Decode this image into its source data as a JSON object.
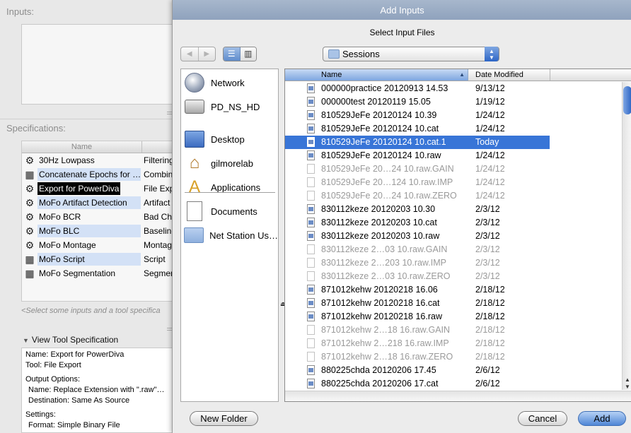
{
  "background": {
    "inputs_label": "Inputs:",
    "specifications_label": "Specifications:",
    "spec_table": {
      "header": "Name",
      "rows": [
        {
          "icon": "gear-icon",
          "name": "30Hz Lowpass",
          "category": "Filtering",
          "style": "plain"
        },
        {
          "icon": "grid-icon",
          "name": "Concatenate Epochs for …",
          "category": "Combin",
          "style": "blue"
        },
        {
          "icon": "gear-icon",
          "name": "Export for PowerDiva",
          "category": "File Exp",
          "style": "selected"
        },
        {
          "icon": "gear-icon",
          "name": "MoFo Artifact Detection",
          "category": "Artifact",
          "style": "blue"
        },
        {
          "icon": "gear-icon",
          "name": "MoFo BCR",
          "category": "Bad Cha",
          "style": "plain"
        },
        {
          "icon": "gear-icon",
          "name": "MoFo BLC",
          "category": "Baseline",
          "style": "blue"
        },
        {
          "icon": "gear-icon",
          "name": "MoFo Montage",
          "category": "Montage",
          "style": "plain"
        },
        {
          "icon": "grid-icon",
          "name": "MoFo Script",
          "category": "Script",
          "style": "blue"
        },
        {
          "icon": "grid-icon",
          "name": "MoFo Segmentation",
          "category": "Segmen",
          "style": "plain"
        }
      ]
    },
    "hint": "<Select some inputs and a tool specifica",
    "view_tool_label": "View Tool Specification",
    "detail_lines": [
      {
        "text": "Name: Export for PowerDiva",
        "indent": false
      },
      {
        "text": "Tool: File Export",
        "indent": false
      },
      {
        "text": "",
        "indent": false
      },
      {
        "text": "Output Options:",
        "indent": false
      },
      {
        "text": "Name: Replace Extension with \".raw\"…",
        "indent": true
      },
      {
        "text": "Destination: Same As Source",
        "indent": true
      },
      {
        "text": "",
        "indent": false
      },
      {
        "text": "Settings:",
        "indent": false
      },
      {
        "text": "Format: Simple Binary File",
        "indent": true
      }
    ]
  },
  "sheet": {
    "title": "Add Inputs",
    "subtitle": "Select Input Files",
    "location": "Sessions",
    "sidebar": [
      {
        "label": "Network",
        "icon": "network-icon"
      },
      {
        "label": "PD_NS_HD",
        "icon": "hard-drive-icon"
      },
      {
        "label": "Desktop",
        "icon": "desktop-icon"
      },
      {
        "label": "gilmorelab",
        "icon": "home-icon"
      },
      {
        "label": "Applications",
        "icon": "applications-icon"
      },
      {
        "label": "Documents",
        "icon": "documents-icon"
      },
      {
        "label": "Net Station Us…",
        "icon": "folder-icon"
      }
    ],
    "columns": {
      "name": "Name",
      "date": "Date Modified"
    },
    "files": [
      {
        "name": "000000practice 20120913 14.53",
        "date": "9/13/12",
        "enabled": true,
        "selected": false
      },
      {
        "name": "000000test 20120119 15.05",
        "date": "1/19/12",
        "enabled": true,
        "selected": false
      },
      {
        "name": "810529JeFe 20120124 10.39",
        "date": "1/24/12",
        "enabled": true,
        "selected": false
      },
      {
        "name": "810529JeFe 20120124 10.cat",
        "date": "1/24/12",
        "enabled": true,
        "selected": false
      },
      {
        "name": "810529JeFe 20120124 10.cat.1",
        "date": "Today",
        "enabled": true,
        "selected": true
      },
      {
        "name": "810529JeFe 20120124 10.raw",
        "date": "1/24/12",
        "enabled": true,
        "selected": false
      },
      {
        "name": "810529JeFe 20…24 10.raw.GAIN",
        "date": "1/24/12",
        "enabled": false,
        "selected": false
      },
      {
        "name": "810529JeFe 20…124 10.raw.IMP",
        "date": "1/24/12",
        "enabled": false,
        "selected": false
      },
      {
        "name": "810529JeFe 20…24 10.raw.ZERO",
        "date": "1/24/12",
        "enabled": false,
        "selected": false
      },
      {
        "name": "830112keze 20120203 10.30",
        "date": "2/3/12",
        "enabled": true,
        "selected": false
      },
      {
        "name": "830112keze 20120203 10.cat",
        "date": "2/3/12",
        "enabled": true,
        "selected": false
      },
      {
        "name": "830112keze 20120203 10.raw",
        "date": "2/3/12",
        "enabled": true,
        "selected": false
      },
      {
        "name": "830112keze 2…03 10.raw.GAIN",
        "date": "2/3/12",
        "enabled": false,
        "selected": false
      },
      {
        "name": "830112keze 2…203 10.raw.IMP",
        "date": "2/3/12",
        "enabled": false,
        "selected": false
      },
      {
        "name": "830112keze 2…03 10.raw.ZERO",
        "date": "2/3/12",
        "enabled": false,
        "selected": false
      },
      {
        "name": "871012kehw 20120218 16.06",
        "date": "2/18/12",
        "enabled": true,
        "selected": false
      },
      {
        "name": "871012kehw 20120218 16.cat",
        "date": "2/18/12",
        "enabled": true,
        "selected": false
      },
      {
        "name": "871012kehw 20120218 16.raw",
        "date": "2/18/12",
        "enabled": true,
        "selected": false
      },
      {
        "name": "871012kehw 2…18 16.raw.GAIN",
        "date": "2/18/12",
        "enabled": false,
        "selected": false
      },
      {
        "name": "871012kehw 2…218 16.raw.IMP",
        "date": "2/18/12",
        "enabled": false,
        "selected": false
      },
      {
        "name": "871012kehw 2…18 16.raw.ZERO",
        "date": "2/18/12",
        "enabled": false,
        "selected": false
      },
      {
        "name": "880225chda 20120206 17.45",
        "date": "2/6/12",
        "enabled": true,
        "selected": false
      },
      {
        "name": "880225chda 20120206 17.cat",
        "date": "2/6/12",
        "enabled": true,
        "selected": false
      }
    ],
    "buttons": {
      "new_folder": "New Folder",
      "cancel": "Cancel",
      "add": "Add"
    }
  }
}
